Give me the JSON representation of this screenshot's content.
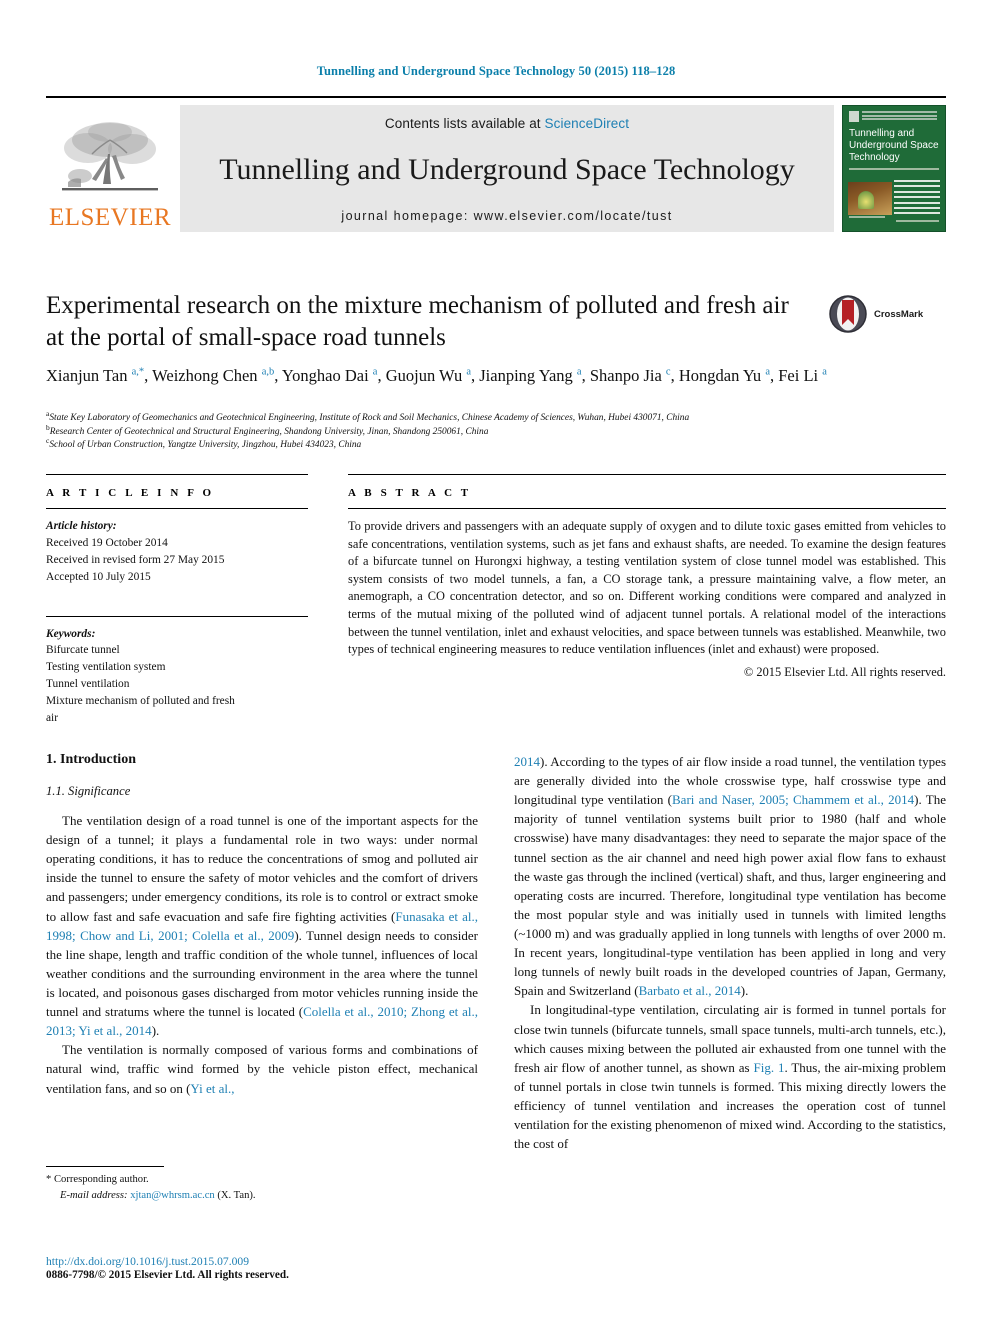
{
  "running_head": "Tunnelling and Underground Space Technology 50 (2015) 118–128",
  "masthead": {
    "publisher": "ELSEVIER",
    "contents_prefix": "Contents lists available at ",
    "sciencedirect": "ScienceDirect",
    "journal_title": "Tunnelling and Underground Space Technology",
    "homepage": "journal homepage: www.elsevier.com/locate/tust",
    "cover_title": "Tunnelling and Underground Space Technology",
    "accent_orange": "#E87722",
    "accent_blue": "#1d7fb3",
    "cover_green": "#1f6b38"
  },
  "article": {
    "title": "Experimental research on the mixture mechanism of polluted and fresh air at the portal of small-space road tunnels",
    "crossmark_label": "CrossMark",
    "authors_html": "Xianjun Tan <sup>a,*</sup>, Weizhong Chen <sup>a,b</sup>, Yonghao Dai <sup>a</sup>, Guojun Wu <sup>a</sup>, Jianping Yang <sup>a</sup>, Shanpo Jia <sup>c</sup>, Hongdan Yu <sup>a</sup>, Fei Li <sup>a</sup>",
    "affiliations": [
      {
        "marker": "a",
        "text": "State Key Laboratory of Geomechanics and Geotechnical Engineering, Institute of Rock and Soil Mechanics, Chinese Academy of Sciences, Wuhan, Hubei 430071, China"
      },
      {
        "marker": "b",
        "text": "Research Center of Geotechnical and Structural Engineering, Shandong University, Jinan, Shandong 250061, China"
      },
      {
        "marker": "c",
        "text": "School of Urban Construction, Yangtze University, Jingzhou, Hubei 434023, China"
      }
    ]
  },
  "article_info": {
    "heading": "A R T I C L E    I N F O",
    "history_label": "Article history:",
    "history": [
      "Received 19 October 2014",
      "Received in revised form 27 May 2015",
      "Accepted 10 July 2015"
    ],
    "keywords_label": "Keywords:",
    "keywords": [
      "Bifurcate tunnel",
      "Testing ventilation system",
      "Tunnel ventilation",
      "Mixture mechanism of polluted and fresh",
      "air"
    ]
  },
  "abstract": {
    "heading": "A B S T R A C T",
    "text": "To provide drivers and passengers with an adequate supply of oxygen and to dilute toxic gases emitted from vehicles to safe concentrations, ventilation systems, such as jet fans and exhaust shafts, are needed. To examine the design features of a bifurcate tunnel on Hurongxi highway, a testing ventilation system of close tunnel model was established. This system consists of two model tunnels, a fan, a CO storage tank, a pressure maintaining valve, a flow meter, an anemograph, a CO concentration detector, and so on. Different working conditions were compared and analyzed in terms of the mutual mixing of the polluted wind of adjacent tunnel portals. A relational model of the interactions between the tunnel ventilation, inlet and exhaust velocities, and space between tunnels was established. Meanwhile, two types of technical engineering measures to reduce ventilation influences (inlet and exhaust) were proposed.",
    "copyright": "© 2015 Elsevier Ltd. All rights reserved."
  },
  "body": {
    "section_number_title": "1. Introduction",
    "subsection_title": "1.1. Significance",
    "left_paragraphs": [
      {
        "parts": [
          {
            "t": "text",
            "v": "The ventilation design of a road tunnel is one of the important aspects for the design of a tunnel; it plays a fundamental role in two ways: under normal operating conditions, it has to reduce the concentrations of smog and polluted air inside the tunnel to ensure the safety of motor vehicles and the comfort of drivers and passengers; under emergency conditions, its role is to control or extract smoke to allow fast and safe evacuation and safe fire fighting activities ("
          },
          {
            "t": "cite",
            "v": "Funasaka et al., 1998; Chow and Li, 2001; Colella et al., 2009"
          },
          {
            "t": "text",
            "v": "). Tunnel design needs to consider the line shape, length and traffic condition of the whole tunnel, influences of local weather conditions and the surrounding environment in the area where the tunnel is located, and poisonous gases discharged from motor vehicles running inside the tunnel and stratums where the tunnel is located ("
          },
          {
            "t": "cite",
            "v": "Colella et al., 2010; Zhong et al., 2013; Yi et al., 2014"
          },
          {
            "t": "text",
            "v": ")."
          }
        ]
      },
      {
        "parts": [
          {
            "t": "text",
            "v": "The ventilation is normally composed of various forms and combinations of natural wind, traffic wind formed by the vehicle piston effect, mechanical ventilation fans, and so on ("
          },
          {
            "t": "cite",
            "v": "Yi et al.,"
          },
          {
            "t": "text",
            "v": ""
          }
        ]
      }
    ],
    "right_paragraphs": [
      {
        "parts": [
          {
            "t": "cite",
            "v": "2014"
          },
          {
            "t": "text",
            "v": "). According to the types of air flow inside a road tunnel, the ventilation types are generally divided into the whole crosswise type, half crosswise type and longitudinal type ventilation ("
          },
          {
            "t": "cite",
            "v": "Bari and Naser, 2005; Chammem et al., 2014"
          },
          {
            "t": "text",
            "v": "). The majority of tunnel ventilation systems built prior to 1980 (half and whole crosswise) have many disadvantages: they need to separate the major space of the tunnel section as the air channel and need high power axial flow fans to exhaust the waste gas through the inclined (vertical) shaft, and thus, larger engineering and operating costs are incurred. Therefore, longitudinal type ventilation has become the most popular style and was initially used in tunnels with limited lengths (~1000 m) and was gradually applied in long tunnels with lengths of over 2000 m. In recent years, longitudinal-type ventilation has been applied in long and very long tunnels of newly built roads in the developed countries of Japan, Germany, Spain and Switzerland ("
          },
          {
            "t": "cite",
            "v": "Barbato et al., 2014"
          },
          {
            "t": "text",
            "v": ")."
          }
        ]
      },
      {
        "parts": [
          {
            "t": "text",
            "v": "In longitudinal-type ventilation, circulating air is formed in tunnel portals for close twin tunnels (bifurcate tunnels, small space tunnels, multi-arch tunnels, etc.), which causes mixing between the polluted air exhausted from one tunnel with the fresh air flow of another tunnel, as shown as "
          },
          {
            "t": "cite",
            "v": "Fig. 1"
          },
          {
            "t": "text",
            "v": ". Thus, the air-mixing problem of tunnel portals in close twin tunnels is formed. This mixing directly lowers the efficiency of tunnel ventilation and increases the operation cost of tunnel ventilation for the existing phenomenon of mixed wind. According to the statistics, the cost of"
          }
        ]
      }
    ]
  },
  "footnotes": {
    "corresponding_marker": "*",
    "corresponding_text": "Corresponding author.",
    "email_label": "E-mail address:",
    "email": "xjtan@whrsm.ac.cn",
    "email_suffix": "(X. Tan).",
    "doi": "http://dx.doi.org/10.1016/j.tust.2015.07.009",
    "issn_line": "0886-7798/© 2015 Elsevier Ltd. All rights reserved."
  }
}
